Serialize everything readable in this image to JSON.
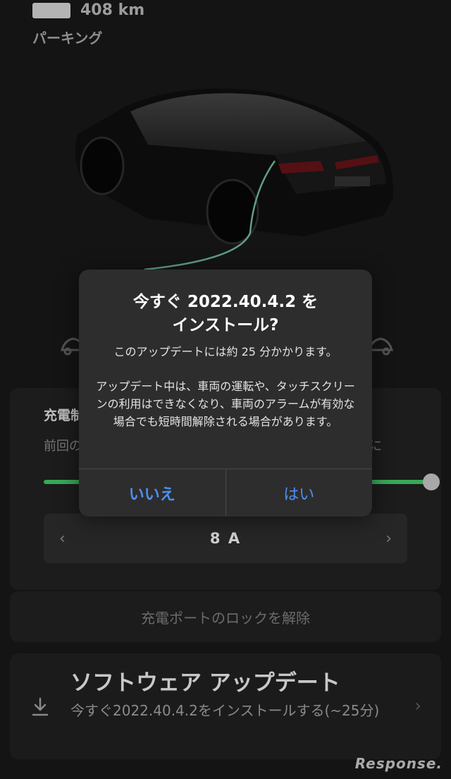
{
  "status": {
    "range": "408 km",
    "gear_state": "パーキング"
  },
  "charging": {
    "title": "充電制限",
    "subtitle": "前回の",
    "subtitle_tail": "に",
    "limit_fraction": 1.0,
    "current": "8 A",
    "accent_color": "#38a858"
  },
  "unlock_port": {
    "label": "充電ポートのロックを解除"
  },
  "software_update": {
    "title": "ソフトウェア アップデート",
    "description": "今すぐ2022.40.4.2をインストールする(~25分)",
    "icon": "download-icon"
  },
  "dialog": {
    "title_line1": "今すぐ 2022.40.4.2 を",
    "title_line2": "インストール?",
    "duration": "このアップデートには約 25 分かかります。",
    "warning": "アップデート中は、車両の運転や、タッチスクリーンの利用はできなくなり、車両のアラームが有効な場合でも短時間解除される場合があります。",
    "no_label": "いいえ",
    "yes_label": "はい",
    "button_color": "#4d8ff2"
  },
  "watermark": "Response."
}
